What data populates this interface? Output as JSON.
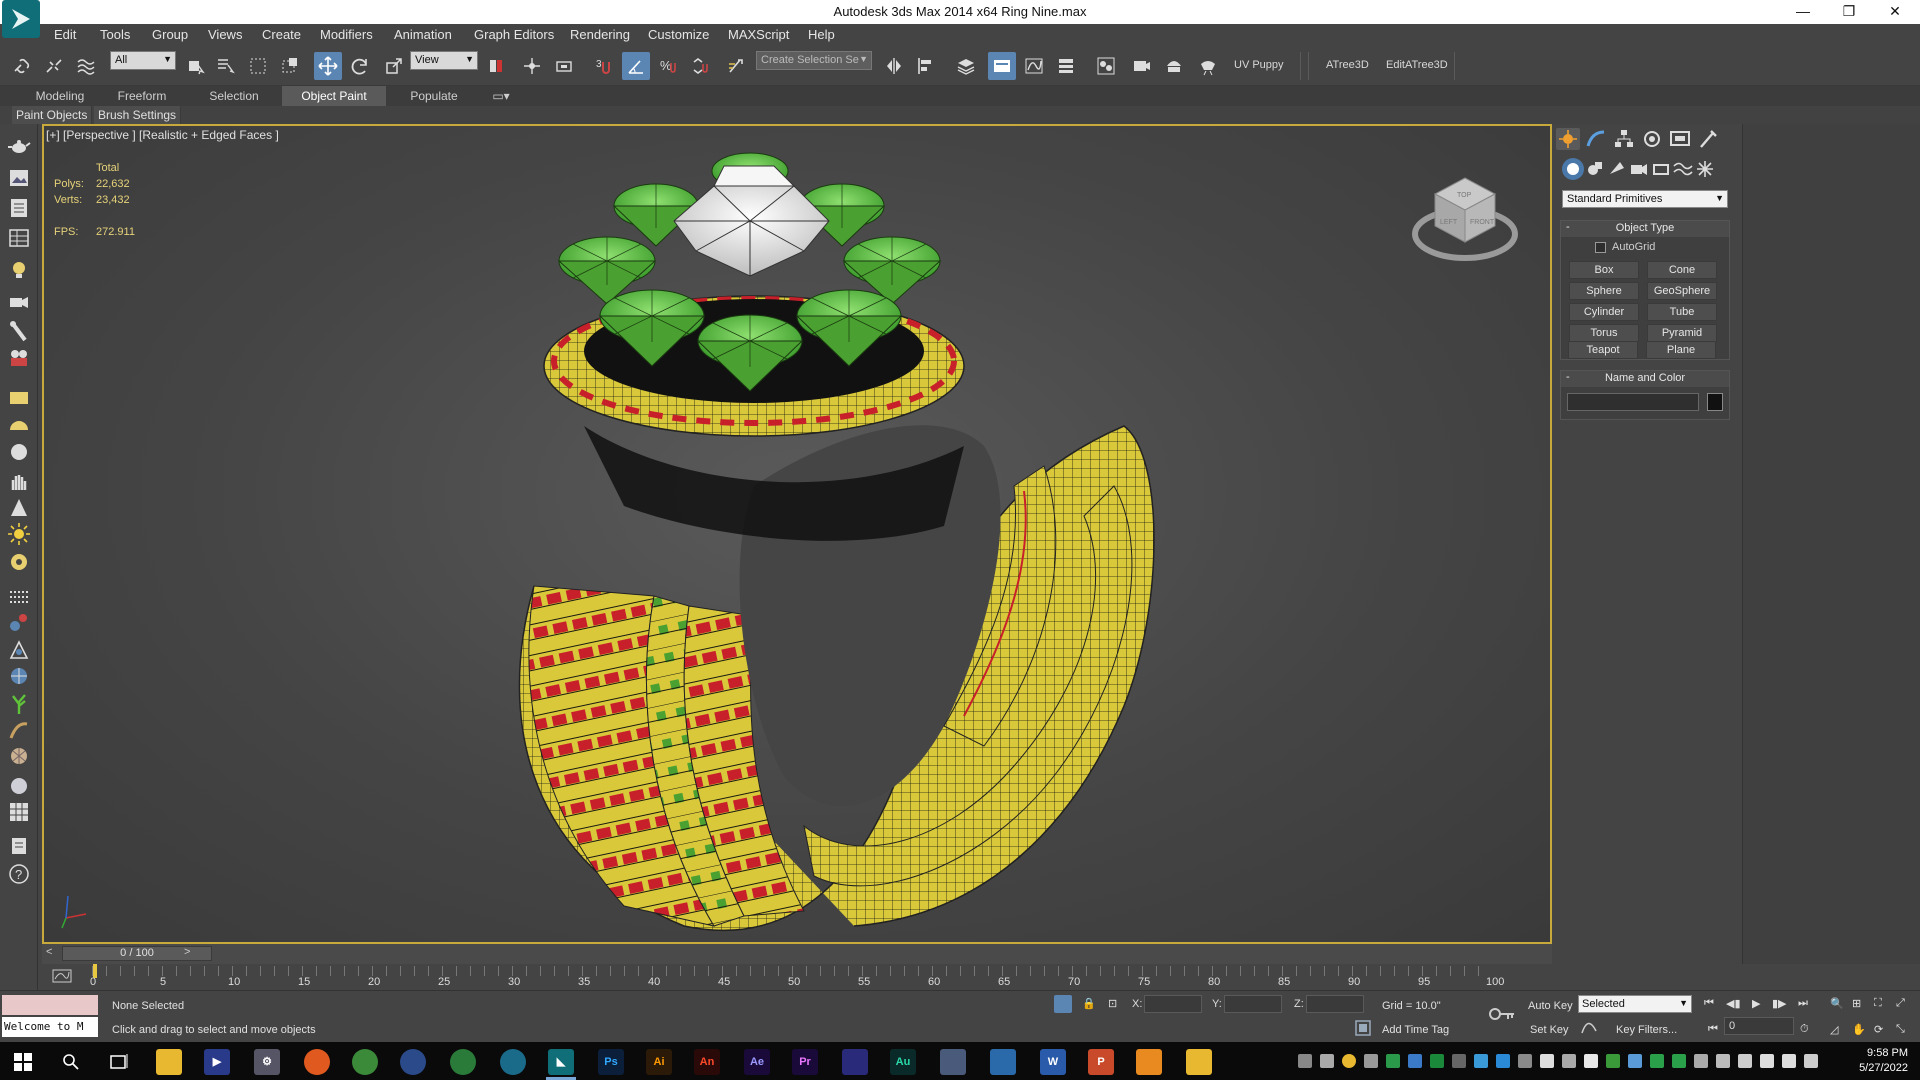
{
  "window": {
    "title": "Autodesk 3ds Max  2014 x64     Ring Nine.max",
    "minimize": "—",
    "maximize": "❐",
    "close": "✕"
  },
  "menu": [
    "Edit",
    "Tools",
    "Group",
    "Views",
    "Create",
    "Modifiers",
    "Animation",
    "Graph Editors",
    "Rendering",
    "Customize",
    "MAXScript",
    "Help"
  ],
  "toolbar": {
    "selection_filter": "All",
    "ref_coord": "View",
    "named_selection": "Create Selection Se",
    "uv_puppy": "UV Puppy",
    "atree": "ATree3D",
    "edit_atree": "EditATree3D"
  },
  "ribbon": {
    "tabs": [
      "Modeling",
      "Freeform",
      "Selection",
      "Object Paint",
      "Populate"
    ],
    "active_tab": "Object Paint",
    "sub": [
      "Paint Objects",
      "Brush Settings"
    ]
  },
  "viewport": {
    "label": "[+] [Perspective ] [Realistic + Edged Faces ]",
    "stats": {
      "total_label": "Total",
      "polys_label": "Polys:",
      "polys": "22,632",
      "verts_label": "Verts:",
      "verts": "23,432",
      "fps_label": "FPS:",
      "fps": "272.911"
    },
    "viewcube": {
      "top": "TOP",
      "left": "LEFT",
      "front": "FRONT"
    }
  },
  "command_panel": {
    "category": "Standard Primitives",
    "object_type_title": "Object Type",
    "autogrid": "AutoGrid",
    "buttons": [
      "Box",
      "Cone",
      "Sphere",
      "GeoSphere",
      "Cylinder",
      "Tube",
      "Torus",
      "Pyramid",
      "Teapot",
      "Plane"
    ],
    "name_color_title": "Name and Color"
  },
  "timeline": {
    "slider": "0 / 100",
    "prev": "<",
    "next": ">",
    "ticks": [
      "0",
      "5",
      "10",
      "15",
      "20",
      "25",
      "30",
      "35",
      "40",
      "45",
      "50",
      "55",
      "60",
      "65",
      "70",
      "75",
      "80",
      "85",
      "90",
      "95",
      "100"
    ]
  },
  "status": {
    "welcome": "Welcome to M",
    "selection": "None Selected",
    "prompt": "Click and drag to select and move objects",
    "x_label": "X:",
    "y_label": "Y:",
    "z_label": "Z:",
    "grid": "Grid = 10.0\"",
    "add_time_tag": "Add Time Tag",
    "auto_key": "Auto Key",
    "set_key": "Set Key",
    "selected": "Selected",
    "key_filters": "Key Filters...",
    "frame": "0"
  },
  "taskbar": {
    "time": "9:58 PM",
    "date": "5/27/2022",
    "apps": [
      "Ps",
      "Ai",
      "An",
      "Ae",
      "Pr",
      "Au",
      "W",
      "P"
    ]
  },
  "colors": {
    "accent": "#5b86b4",
    "viewport_border": "#c8aa3c",
    "ring_gold": "#d8c83a",
    "ring_red": "#c8202a",
    "gem_green": "#5fc43a",
    "gem_white": "#e8e8e8"
  }
}
